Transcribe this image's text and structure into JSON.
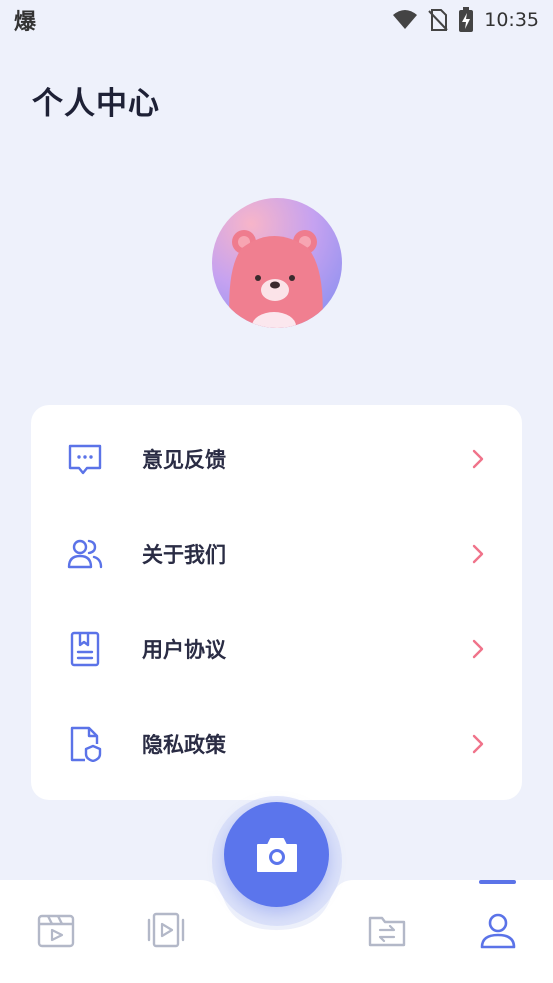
{
  "status_bar": {
    "left_glyph": "爆",
    "time": "10:35",
    "icons": [
      "wifi-icon",
      "no-sim-icon",
      "battery-charging-icon"
    ]
  },
  "page": {
    "title": "个人中心"
  },
  "avatar": {
    "icon": "bear-avatar"
  },
  "menu": {
    "items": [
      {
        "label": "意见反馈",
        "icon": "feedback-icon"
      },
      {
        "label": "关于我们",
        "icon": "users-icon"
      },
      {
        "label": "用户协议",
        "icon": "agreement-icon"
      },
      {
        "label": "隐私政策",
        "icon": "privacy-icon"
      }
    ],
    "chevron_color": "#f0738a"
  },
  "bottom_nav": {
    "tabs": [
      {
        "icon": "clapper-icon",
        "active": false
      },
      {
        "icon": "video-icon",
        "active": false
      },
      {
        "icon": "folder-transfer-icon",
        "active": false
      },
      {
        "icon": "profile-icon",
        "active": true
      }
    ],
    "center_action": "camera-icon"
  },
  "colors": {
    "background": "#eef1fb",
    "accent": "#5b75ec",
    "icon": "#5b73e8",
    "inactive_icon": "#b3b8c8"
  }
}
